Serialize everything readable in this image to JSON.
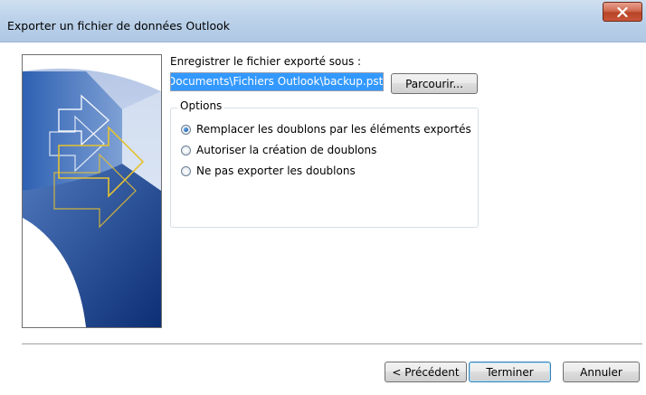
{
  "window": {
    "title": "Exporter un fichier de données Outlook",
    "close_label": "X"
  },
  "form": {
    "save_label": "Enregistrer le fichier exporté sous :",
    "path_value": "Documents\\Fichiers Outlook\\backup.pst",
    "browse_label": "Parcourir..."
  },
  "options": {
    "legend": "Options",
    "items": [
      {
        "label": "Remplacer les doublons par les éléments exportés",
        "checked": true
      },
      {
        "label": "Autoriser la création de doublons",
        "checked": false
      },
      {
        "label": "Ne pas exporter les doublons",
        "checked": false
      }
    ]
  },
  "buttons": {
    "back": "< Précédent",
    "finish": "Terminer",
    "cancel": "Annuler"
  },
  "colors": {
    "accent": "#3399ff",
    "close": "#c9553a",
    "art_blue": "#1e4fa0",
    "art_arrow": "#e6c230"
  },
  "icons": {
    "close": "close-icon",
    "art": "wizard-illustration"
  }
}
